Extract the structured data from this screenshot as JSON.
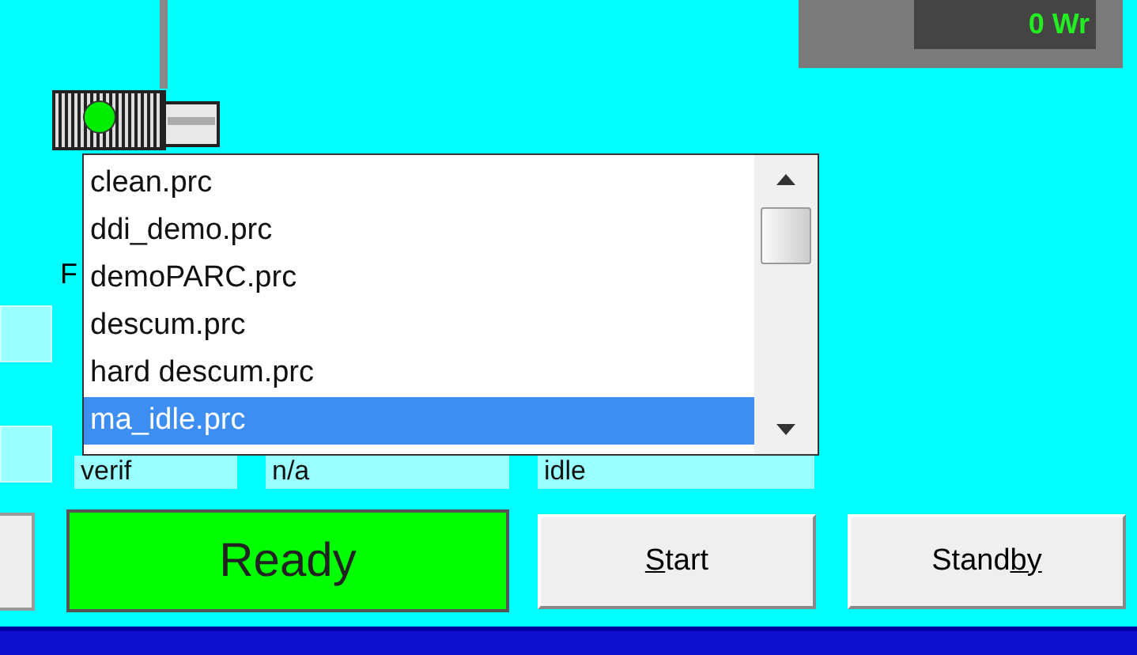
{
  "power_readout": "0 Wr",
  "side_labels": [
    "F"
  ],
  "status_fields": [
    "verif",
    "n/a",
    "idle"
  ],
  "process_list": {
    "items": [
      {
        "label": "clean.prc",
        "selected": false
      },
      {
        "label": "ddi_demo.prc",
        "selected": false
      },
      {
        "label": "demoPARC.prc",
        "selected": false
      },
      {
        "label": "descum.prc",
        "selected": false
      },
      {
        "label": "hard descum.prc",
        "selected": false
      },
      {
        "label": "ma_idle.prc",
        "selected": true
      }
    ]
  },
  "status_indicator": {
    "label": "Ready"
  },
  "buttons": [
    {
      "label_segments": [
        {
          "text": "S",
          "underlined": true
        },
        {
          "text": "tart",
          "underlined": false
        }
      ]
    },
    {
      "label_segments": [
        {
          "text": "Stand",
          "underlined": false
        },
        {
          "text": "by",
          "underlined": true
        }
      ]
    }
  ]
}
